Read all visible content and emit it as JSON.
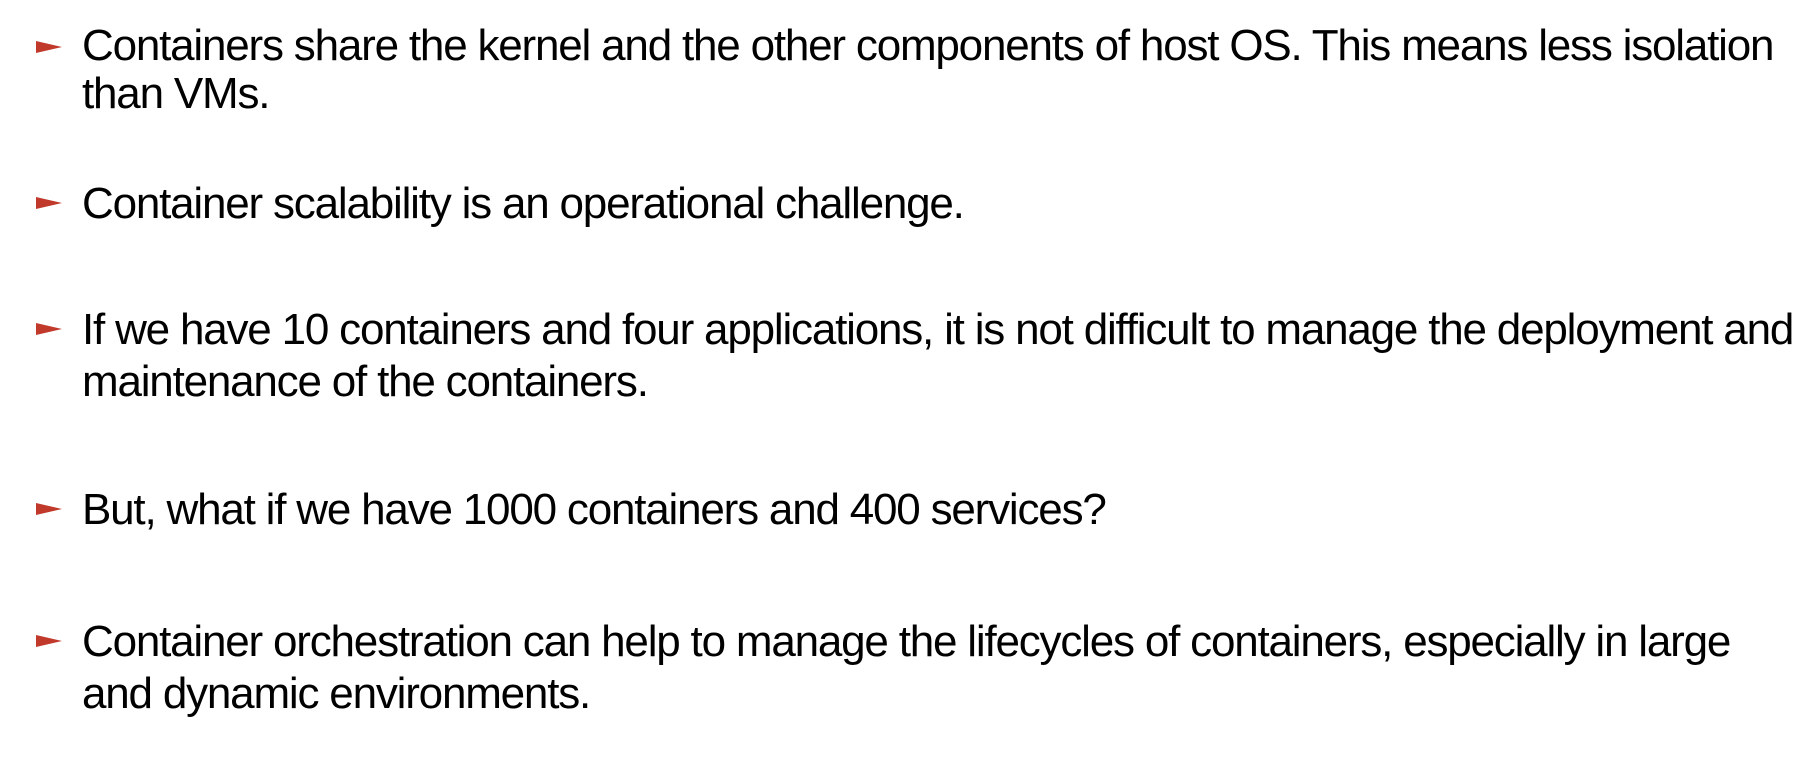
{
  "slide": {
    "accent_color": "#c0392b",
    "bullet_icon": "triangle-right-icon",
    "bullets": [
      {
        "text": "Containers share the kernel and the other components of host OS. This means less isolation than VMs."
      },
      {
        "text": "Container scalability is an operational challenge."
      },
      {
        "text": "If we have 10 containers and four applications, it is not difficult to manage the deployment and maintenance of the containers."
      },
      {
        "text": "But, what if we have 1000 containers and 400 services?"
      },
      {
        "text": "Container orchestration can help to manage the lifecycles of containers, especially in large and dynamic environments."
      }
    ]
  }
}
